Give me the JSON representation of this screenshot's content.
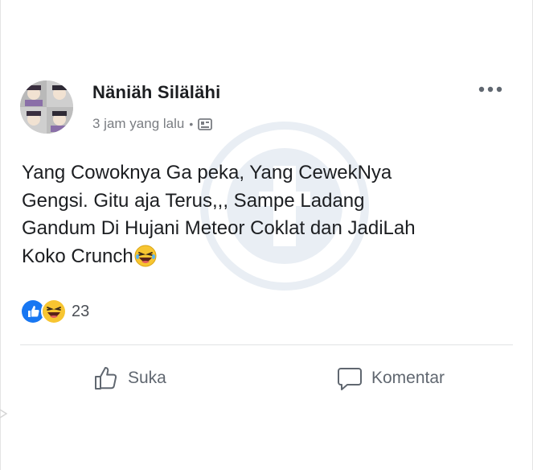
{
  "post": {
    "author": "Näniäh Silälähi",
    "timestamp": "3 jam yang lalu",
    "separator": "•",
    "privacy_icon": "photo-album-icon",
    "text": "Yang Cowoknya Ga peka, Yang CewekNya\nGengsi. Gitu aja Terus,,, Sampe Ladang\nGandum Di Hujani Meteor Coklat dan JadiLah\nKoko Crunch"
  },
  "reactions": {
    "icons": [
      "like-reaction-icon",
      "haha-reaction-icon"
    ],
    "count": "23"
  },
  "actions": {
    "like_label": "Suka",
    "comment_label": "Komentar"
  },
  "colors": {
    "like_blue": "#1877f2",
    "haha_yellow": "#f7c531",
    "muted_text": "#606770"
  }
}
